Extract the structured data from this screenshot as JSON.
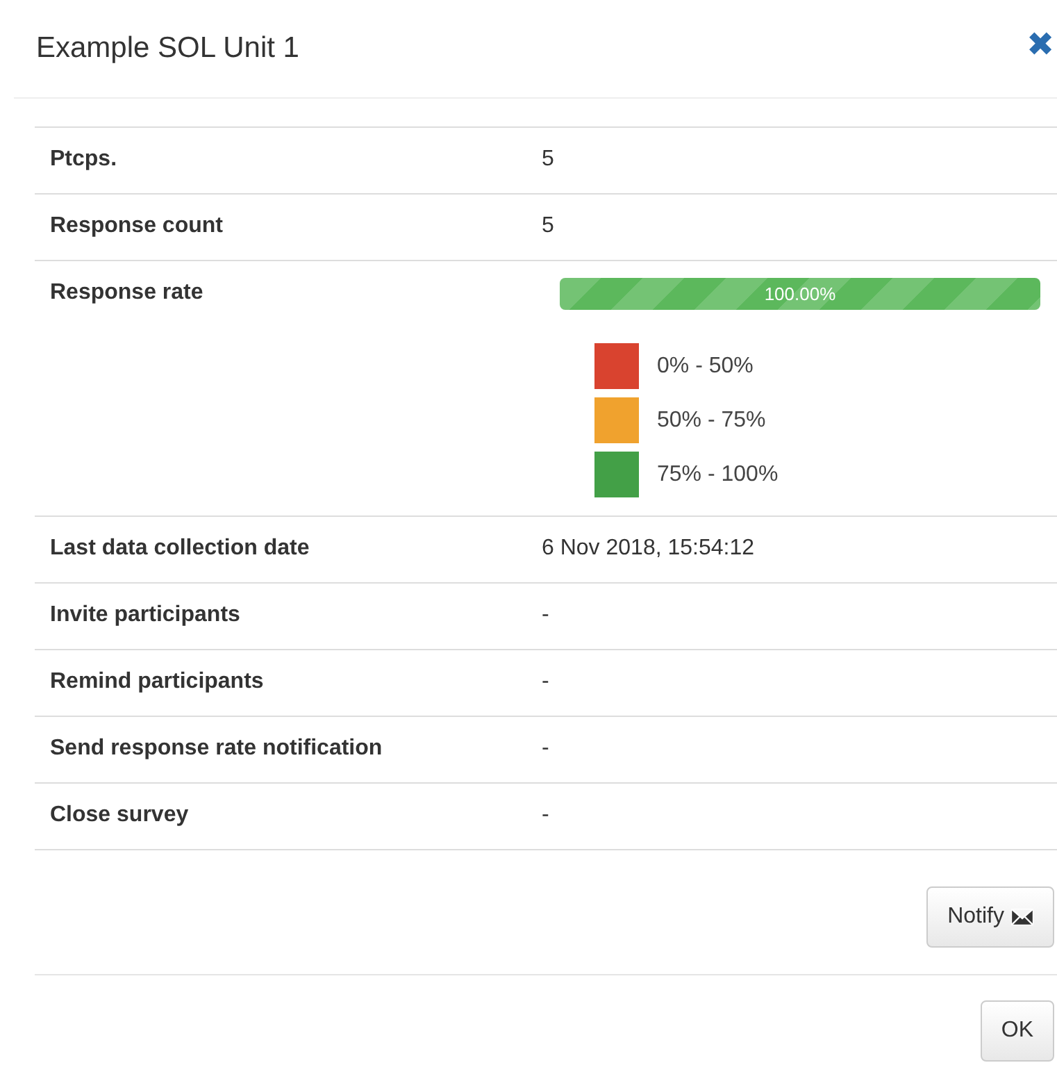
{
  "dialog": {
    "title": "Example SOL Unit 1",
    "close_icon": "✖"
  },
  "rows": [
    {
      "kind": "text",
      "label": "Ptcps.",
      "value": "5"
    },
    {
      "kind": "text",
      "label": "Response count",
      "value": "5"
    },
    {
      "kind": "progress",
      "label": "Response rate",
      "level": 1,
      "reading": "100.00%",
      "color": "#5cb85c",
      "legend": [
        {
          "color": "#d9432f",
          "label": "0% - 50%"
        },
        {
          "color": "#f0a22e",
          "label": "50% - 75%"
        },
        {
          "color": "#43a047",
          "label": "75% - 100%"
        }
      ]
    },
    {
      "kind": "text",
      "label": "Last data collection date",
      "value": "6 Nov 2018, 15:54:12"
    },
    {
      "kind": "text",
      "label": "Invite participants",
      "value": "-"
    },
    {
      "kind": "text",
      "label": "Remind participants",
      "value": "-"
    },
    {
      "kind": "text",
      "label": "Send response rate notification",
      "value": "-"
    },
    {
      "kind": "text",
      "label": "Close survey",
      "value": "-"
    }
  ],
  "notify_button": "Notify",
  "ok_button": "OK"
}
